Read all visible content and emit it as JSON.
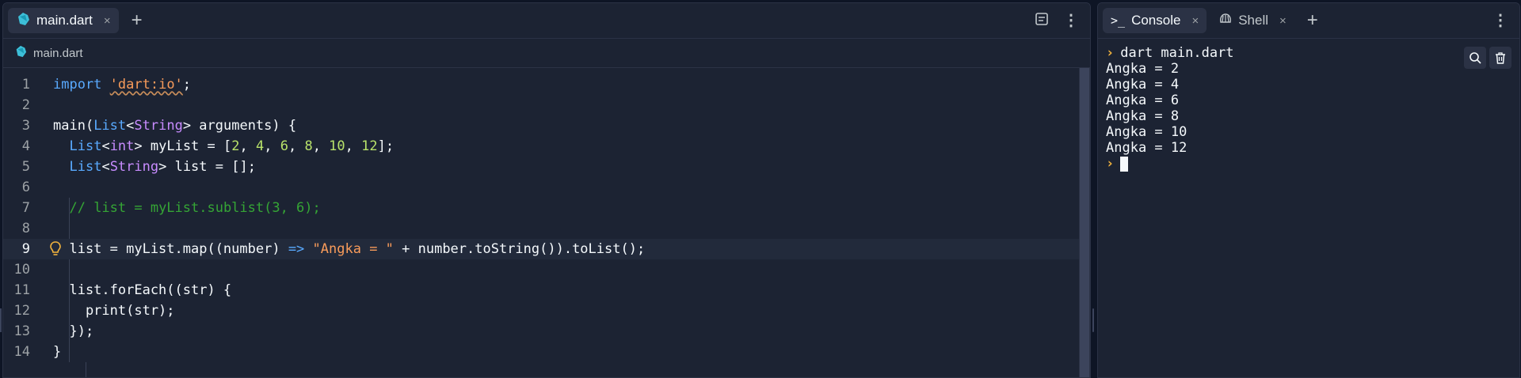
{
  "editor": {
    "tab": {
      "label": "main.dart",
      "close": "×"
    },
    "add_tab": "+",
    "breadcrumb": "main.dart",
    "current_line": 9
  },
  "code_lines": [
    {
      "n": "1",
      "html": "<span class=\"k-kw\">import</span> <span class=\"k-str squig\">'dart:io'</span>;"
    },
    {
      "n": "2",
      "html": ""
    },
    {
      "n": "3",
      "html": "main(<span class=\"k-typ\">List</span>&lt;<span class=\"k-gen\">String</span>&gt; arguments) {"
    },
    {
      "n": "4",
      "html": "  <span class=\"k-typ\">List</span>&lt;<span class=\"k-gen\">int</span>&gt; myList = [<span class=\"k-num\">2</span>, <span class=\"k-num\">4</span>, <span class=\"k-num\">6</span>, <span class=\"k-num\">8</span>, <span class=\"k-num\">10</span>, <span class=\"k-num\">12</span>];"
    },
    {
      "n": "5",
      "html": "  <span class=\"k-typ\">List</span>&lt;<span class=\"k-gen\">String</span>&gt; list = [];"
    },
    {
      "n": "6",
      "html": ""
    },
    {
      "n": "7",
      "html": "  <span class=\"k-cmt\">// list = myList.sublist(3, 6);</span>"
    },
    {
      "n": "8",
      "html": ""
    },
    {
      "n": "9",
      "html": "  list = myList.map((number) <span class=\"k-kw\">=&gt;</span> <span class=\"k-str\">\"Angka = \"</span> + number.toString()).toList();"
    },
    {
      "n": "10",
      "html": ""
    },
    {
      "n": "11",
      "html": "  list.forEach((str) {"
    },
    {
      "n": "12",
      "html": "    print(str);"
    },
    {
      "n": "13",
      "html": "  });"
    },
    {
      "n": "14",
      "html": "}"
    }
  ],
  "console": {
    "tabs": [
      {
        "label": "Console",
        "close": "×"
      },
      {
        "label": "Shell",
        "close": "×"
      }
    ],
    "add_tab": "+",
    "command": "dart main.dart",
    "output": [
      "Angka = 2",
      "Angka = 4",
      "Angka = 6",
      "Angka = 8",
      "Angka = 10",
      "Angka = 12"
    ],
    "prompt_symbol": "›"
  },
  "colors": {
    "background": "#0e1525",
    "panel": "#1c2333",
    "keyword": "#59aaff",
    "string": "#f89b5a",
    "number": "#b8e26a",
    "comment": "#35a535",
    "prompt": "#f2b33d"
  },
  "icons": [
    "dart-icon",
    "close-icon",
    "plus-icon",
    "outline-icon",
    "kebab-menu-icon",
    "lightbulb-icon",
    "console-icon",
    "shell-icon",
    "search-icon",
    "trash-icon"
  ]
}
